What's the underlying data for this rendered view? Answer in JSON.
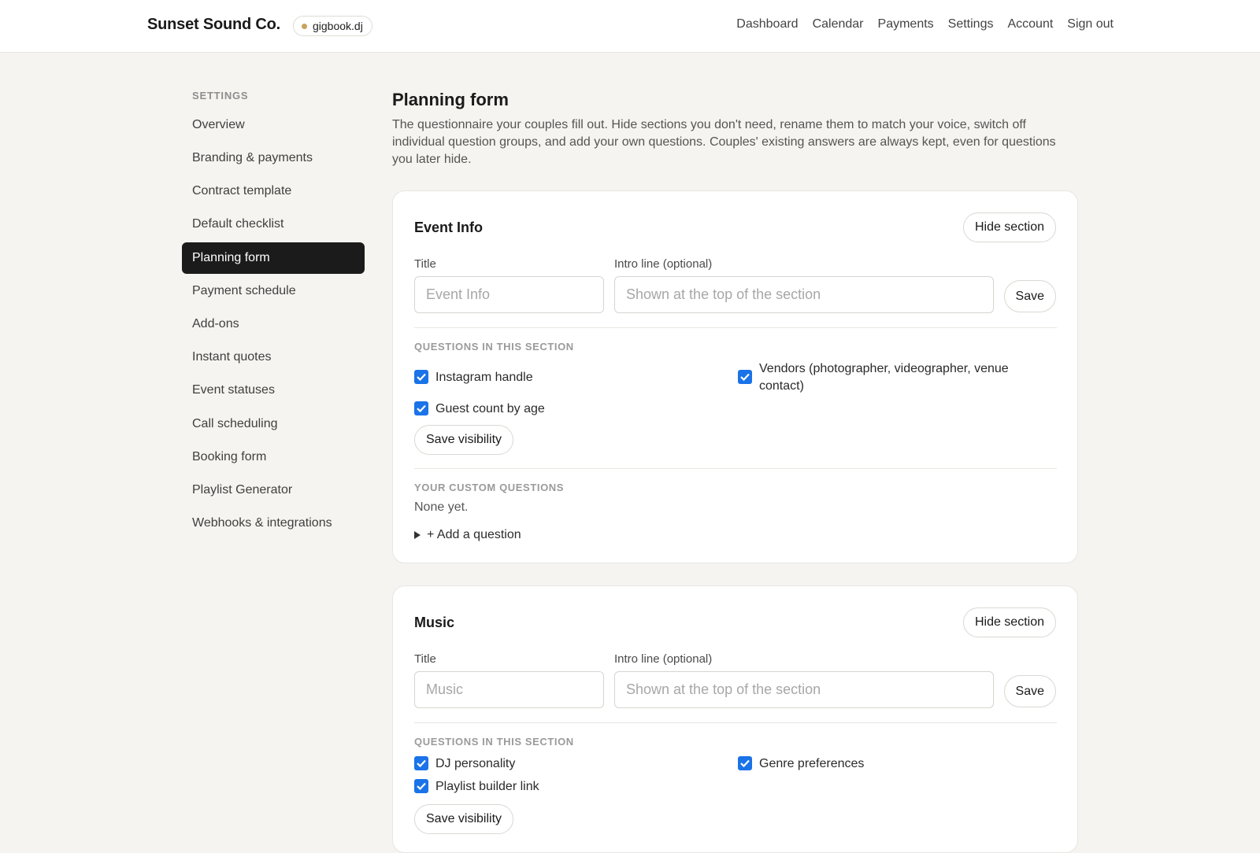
{
  "header": {
    "brand": "Sunset Sound Co.",
    "badge": "gigbook.dj",
    "badge_dot_color": "#c9a25c",
    "nav": [
      "Dashboard",
      "Calendar",
      "Payments",
      "Settings",
      "Account",
      "Sign out"
    ]
  },
  "sidebar": {
    "heading": "SETTINGS",
    "items": [
      {
        "label": "Overview"
      },
      {
        "label": "Branding & payments"
      },
      {
        "label": "Contract template"
      },
      {
        "label": "Default checklist"
      },
      {
        "label": "Planning form",
        "active": true
      },
      {
        "label": "Payment schedule"
      },
      {
        "label": "Add-ons"
      },
      {
        "label": "Instant quotes"
      },
      {
        "label": "Event statuses"
      },
      {
        "label": "Call scheduling"
      },
      {
        "label": "Booking form"
      },
      {
        "label": "Playlist Generator"
      },
      {
        "label": "Webhooks & integrations"
      }
    ]
  },
  "main": {
    "title": "Planning form",
    "description": "The questionnaire your couples fill out. Hide sections you don't need, rename them to match your voice, switch off individual question groups, and add your own questions. Couples' existing answers are always kept, even for questions you later hide.",
    "sections": [
      {
        "name": "Event Info",
        "hide_label": "Hide section",
        "title_label": "Title",
        "title_placeholder": "Event Info",
        "intro_label": "Intro line (optional)",
        "intro_placeholder": "Shown at the top of the section",
        "save_label": "Save",
        "questions_heading": "QUESTIONS IN THIS SECTION",
        "questions": [
          {
            "label": "Instagram handle",
            "checked": true
          },
          {
            "label": "Vendors (photographer, videographer, venue contact)",
            "checked": true
          },
          {
            "label": "Guest count by age",
            "checked": true
          }
        ],
        "save_visibility_label": "Save visibility",
        "custom_heading": "YOUR CUSTOM QUESTIONS",
        "custom_empty": "None yet.",
        "add_question_label": "+ Add a question"
      },
      {
        "name": "Music",
        "hide_label": "Hide section",
        "title_label": "Title",
        "title_placeholder": "Music",
        "intro_label": "Intro line (optional)",
        "intro_placeholder": "Shown at the top of the section",
        "save_label": "Save",
        "questions_heading": "QUESTIONS IN THIS SECTION",
        "questions": [
          {
            "label": "DJ personality",
            "checked": true
          },
          {
            "label": "Genre preferences",
            "checked": true
          },
          {
            "label": "Playlist builder link",
            "checked": true
          }
        ],
        "save_visibility_label": "Save visibility"
      }
    ]
  },
  "colors": {
    "page_bg": "#f5f4f0",
    "accent_checkbox": "#1a73e8",
    "active_nav_bg": "#1b1b1b"
  }
}
